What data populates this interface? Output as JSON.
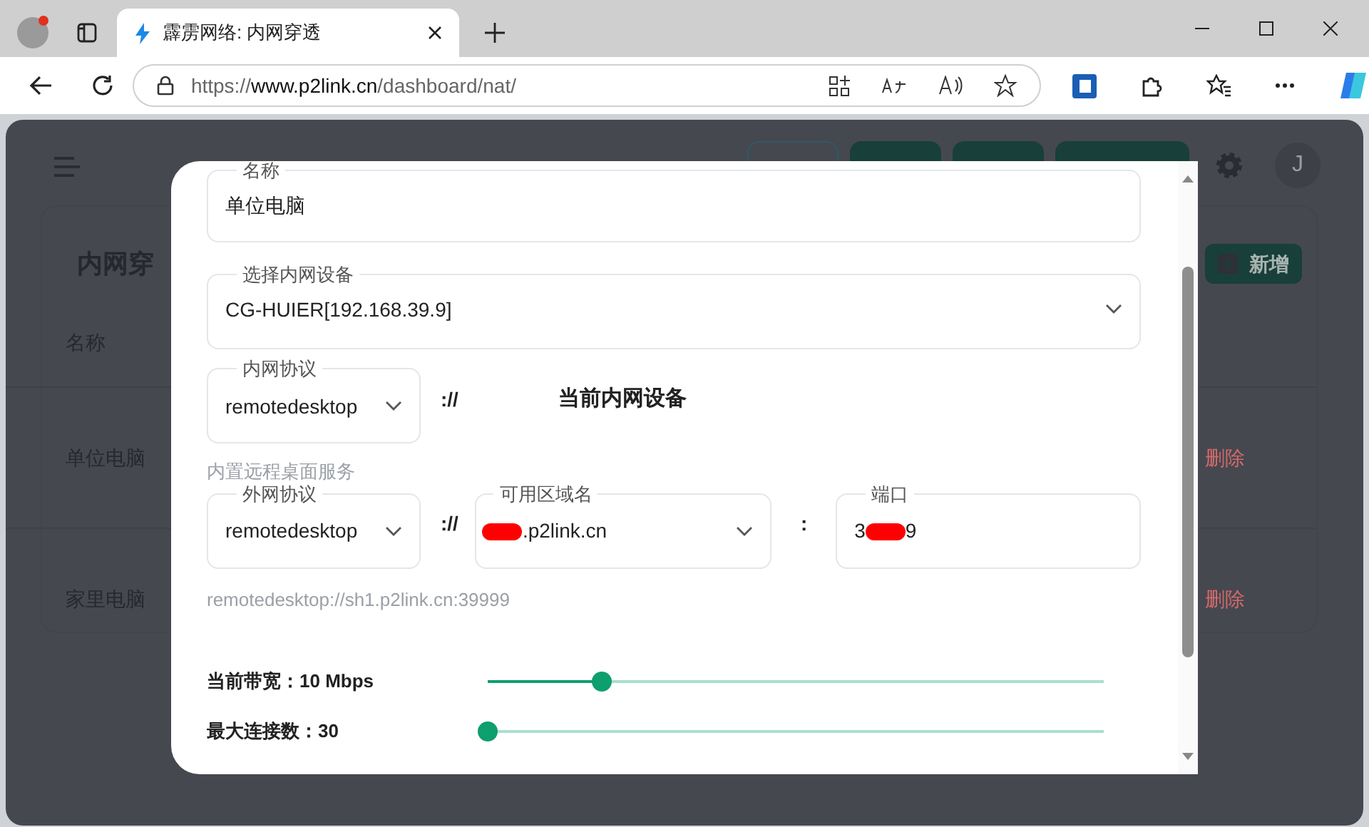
{
  "browser": {
    "tab": {
      "title": "霹雳网络: 内网穿透",
      "selected": true
    },
    "url": {
      "scheme": "https://",
      "host": "www.p2link.cn",
      "path": "/dashboard/nat/"
    }
  },
  "page": {
    "title": "内网穿",
    "add_button": "新增",
    "column_1": "名称",
    "rows": [
      {
        "name": "单位电脑",
        "delete": "删除"
      },
      {
        "name": "家里电脑",
        "delete": "删除"
      }
    ],
    "avatar": "J"
  },
  "dialog": {
    "name": {
      "label": "名称",
      "value": "单位电脑"
    },
    "device": {
      "label": "选择内网设备",
      "value": "CG-HUIER[192.168.39.9]"
    },
    "internal_protocol": {
      "label": "内网协议",
      "value": "remotedesktop"
    },
    "internal_separator": "://",
    "internal_target": "当前内网设备",
    "helper": "内置远程桌面服务",
    "external_protocol": {
      "label": "外网协议",
      "value": "remotedesktop"
    },
    "external_separator": "://",
    "domain": {
      "label": "可用区域名",
      "value": ".p2link.cn"
    },
    "port_separator": ":",
    "port": {
      "label": "端口",
      "value_start": "3",
      "value_end": "9"
    },
    "address": "remotedesktop://sh1.p2link.cn:39999",
    "sliders": [
      {
        "label": "当前带宽：10 Mbps",
        "level": 0.185
      },
      {
        "label": "最大连接数：30",
        "level": 0
      }
    ]
  }
}
